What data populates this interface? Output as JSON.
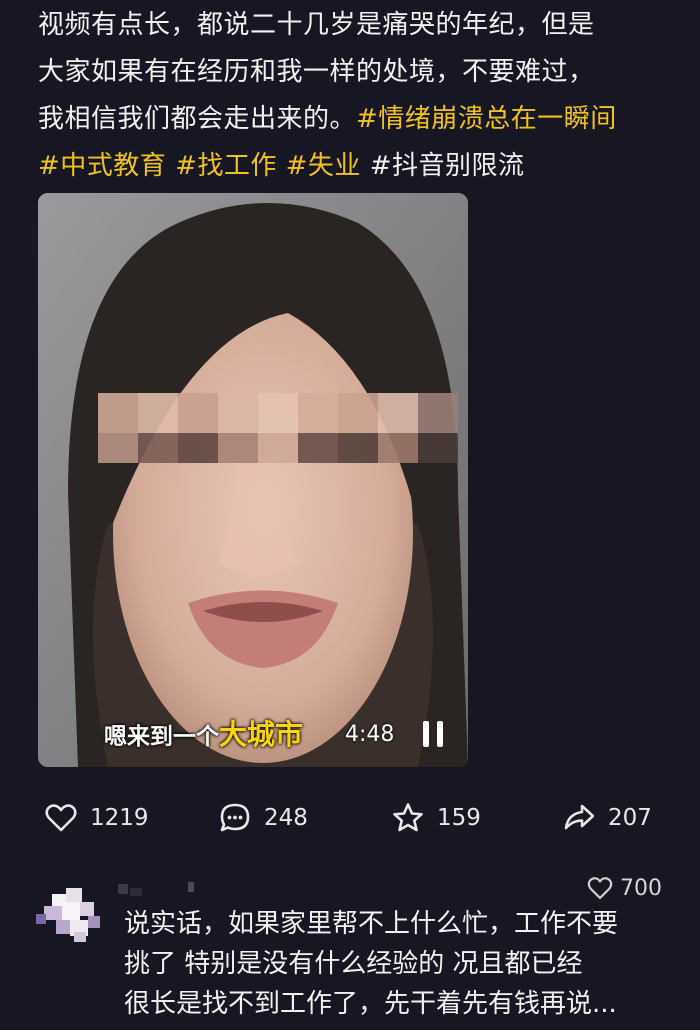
{
  "post": {
    "text_lines": [
      "视频有点长，都说二十几岁是痛哭的年纪，但是",
      "大家如果有在经历和我一样的处境，不要难过，",
      "我相信我们都会走出来的。"
    ],
    "hashtags": [
      "#情绪崩溃总在一瞬间",
      "#中式教育",
      "#找工作",
      "#失业",
      "#抖音别限流"
    ]
  },
  "video": {
    "caption_prefix": "嗯来到一个",
    "caption_highlight": "大城市",
    "timestamp": "4:48"
  },
  "actions": {
    "likes": "1219",
    "comments": "248",
    "favorites": "159",
    "shares": "207"
  },
  "comment": {
    "likes": "700",
    "text_lines": [
      "说实话，如果家里帮不上什么忙，工作不要",
      "挑了 特别是没有什么经验的 况且都已经",
      "很长是找不到工作了，先干着先有钱再说..."
    ]
  },
  "colors": {
    "background": "#161722",
    "hashtag": "#f2c21b",
    "caption_highlight": "#ffd400"
  },
  "icons": {
    "likes": "heart-icon",
    "comments": "comment-icon",
    "favorites": "star-icon",
    "shares": "share-icon",
    "pause": "pause-icon"
  }
}
